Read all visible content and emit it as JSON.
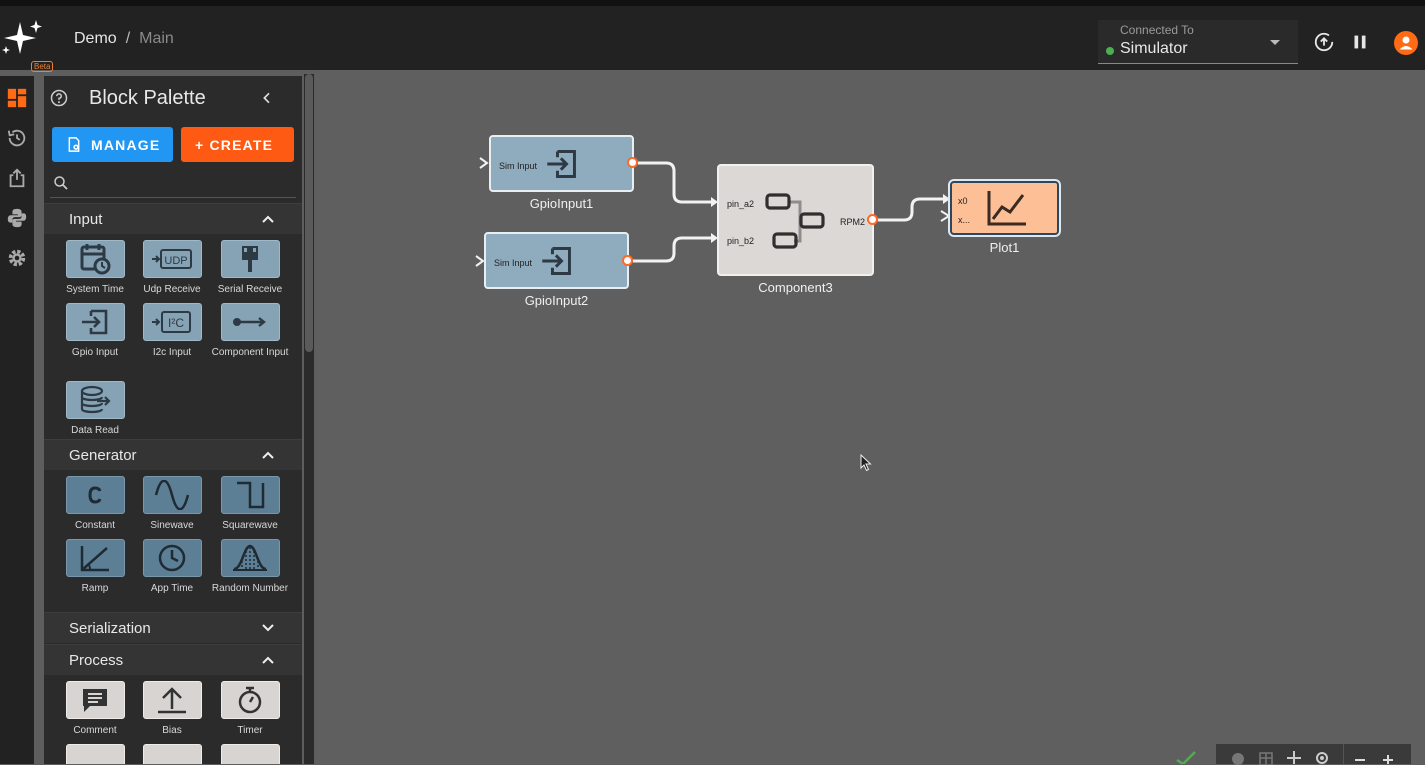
{
  "header": {
    "logo_badge": "Beta",
    "breadcrumb": {
      "project": "Demo",
      "separator": "/",
      "page": "Main"
    },
    "connection": {
      "label": "Connected To",
      "value": "Simulator",
      "status_color": "#4caf50"
    },
    "icons": [
      "upload-status-icon",
      "pause-icon",
      "account-icon"
    ]
  },
  "rail": {
    "icons": [
      "dashboard-icon",
      "history-icon",
      "export-icon",
      "python-icon",
      "settings-icon"
    ]
  },
  "palette": {
    "title": "Block Palette",
    "manage_label": "MANAGE",
    "create_label": "+ CREATE",
    "search_placeholder": "",
    "sections": {
      "input": {
        "title": "Input",
        "expanded": true,
        "items": [
          "System Time",
          "Udp Receive",
          "Serial Receive",
          "Gpio Input",
          "I2c Input",
          "Component Input",
          "Data Read"
        ]
      },
      "generator": {
        "title": "Generator",
        "expanded": true,
        "items": [
          "Constant",
          "Sinewave",
          "Squarewave",
          "Ramp",
          "App Time",
          "Random Number"
        ]
      },
      "serialization": {
        "title": "Serialization",
        "expanded": false
      },
      "process": {
        "title": "Process",
        "expanded": true,
        "items": [
          "Comment",
          "Bias",
          "Timer"
        ]
      }
    }
  },
  "canvas": {
    "blocks": {
      "gpio1": {
        "caption": "GpioInput1",
        "inner": "Sim Input"
      },
      "gpio2": {
        "caption": "GpioInput2",
        "inner": "Sim Input"
      },
      "component": {
        "caption": "Component3",
        "in_a": "pin_a2",
        "in_b": "pin_b2",
        "out": "RPM2"
      },
      "plot": {
        "caption": "Plot1",
        "in_0": "x0",
        "in_1": "x..."
      }
    },
    "colors": {
      "input_block": "#8fabbe",
      "component_block": "#dcd8d6",
      "plot_block": "#fdbf96",
      "port_ring": "#ff6a2a"
    }
  }
}
